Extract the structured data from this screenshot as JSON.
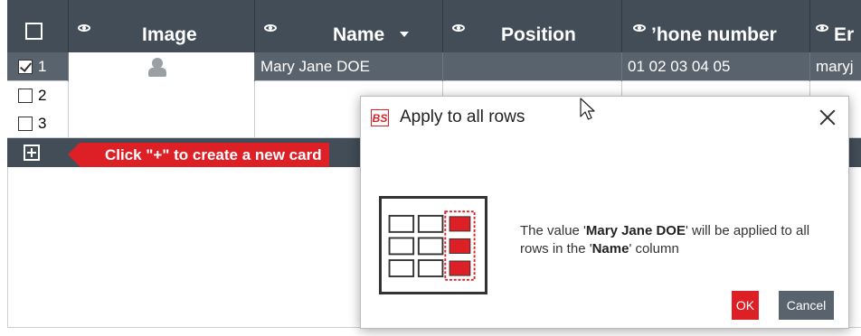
{
  "header": {
    "columns": [
      {
        "label": "Image"
      },
      {
        "label": "Name"
      },
      {
        "label": "Position"
      },
      {
        "label": "’hone number"
      },
      {
        "label": "Er"
      }
    ],
    "icon": "eye-icon"
  },
  "rows": [
    {
      "num": "1",
      "checked": true,
      "name": "Mary Jane DOE",
      "position": "",
      "phone": "01 02 03 04 05",
      "email": "maryj"
    },
    {
      "num": "2",
      "checked": false
    },
    {
      "num": "3",
      "checked": false
    }
  ],
  "hint": "Click \"+\" to create a new card",
  "dialog": {
    "logo": "BS",
    "title": "Apply to all rows",
    "msg_pre": "The value '",
    "msg_value": "Mary Jane DOE",
    "msg_mid": "' will be applied to all rows in the '",
    "msg_column": "Name",
    "msg_post": "' column",
    "ok": "OK",
    "cancel": "Cancel"
  },
  "colors": {
    "header": "#424d57",
    "selected_row": "#59636d",
    "accent": "#dd1f26"
  }
}
